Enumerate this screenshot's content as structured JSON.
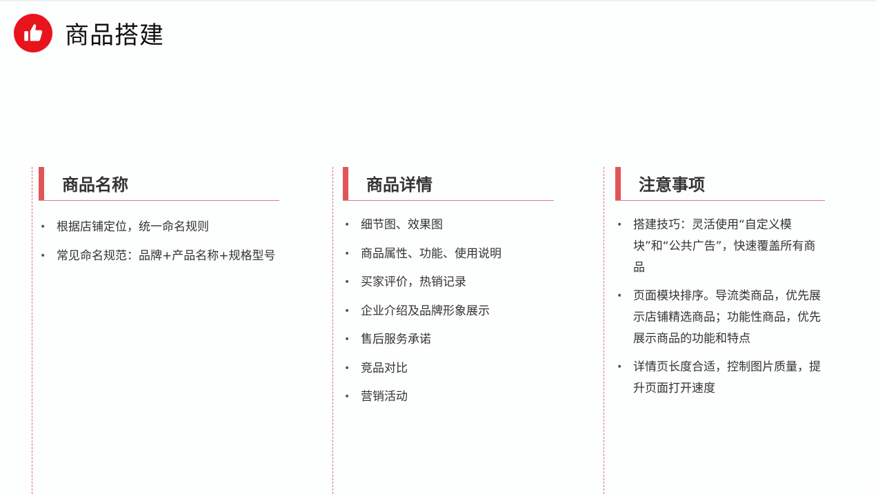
{
  "title": "商品搭建",
  "icons": {
    "logo": "thumbs-up-icon",
    "logo_color": "#e8141c",
    "accent": "#e05656"
  },
  "columns": [
    {
      "heading": "商品名称",
      "items": [
        "根据店铺定位，统一命名规则",
        "常见命名规范：品牌+产品名称+规格型号"
      ]
    },
    {
      "heading": "商品详情",
      "items": [
        "细节图、效果图",
        "商品属性、功能、使用说明",
        "买家评价，热销记录",
        "企业介绍及品牌形象展示",
        "售后服务承诺",
        "竞品对比",
        "营销活动"
      ]
    },
    {
      "heading": "注意事项",
      "items": [
        "搭建技巧：灵活使用“自定义模块”和“公共广告”，快速覆盖所有商品",
        "页面模块排序。导流类商品，优先展示店铺精选商品；功能性商品，优先展示商品的功能和特点",
        "详情页长度合适，控制图片质量，提升页面打开速度"
      ]
    }
  ]
}
